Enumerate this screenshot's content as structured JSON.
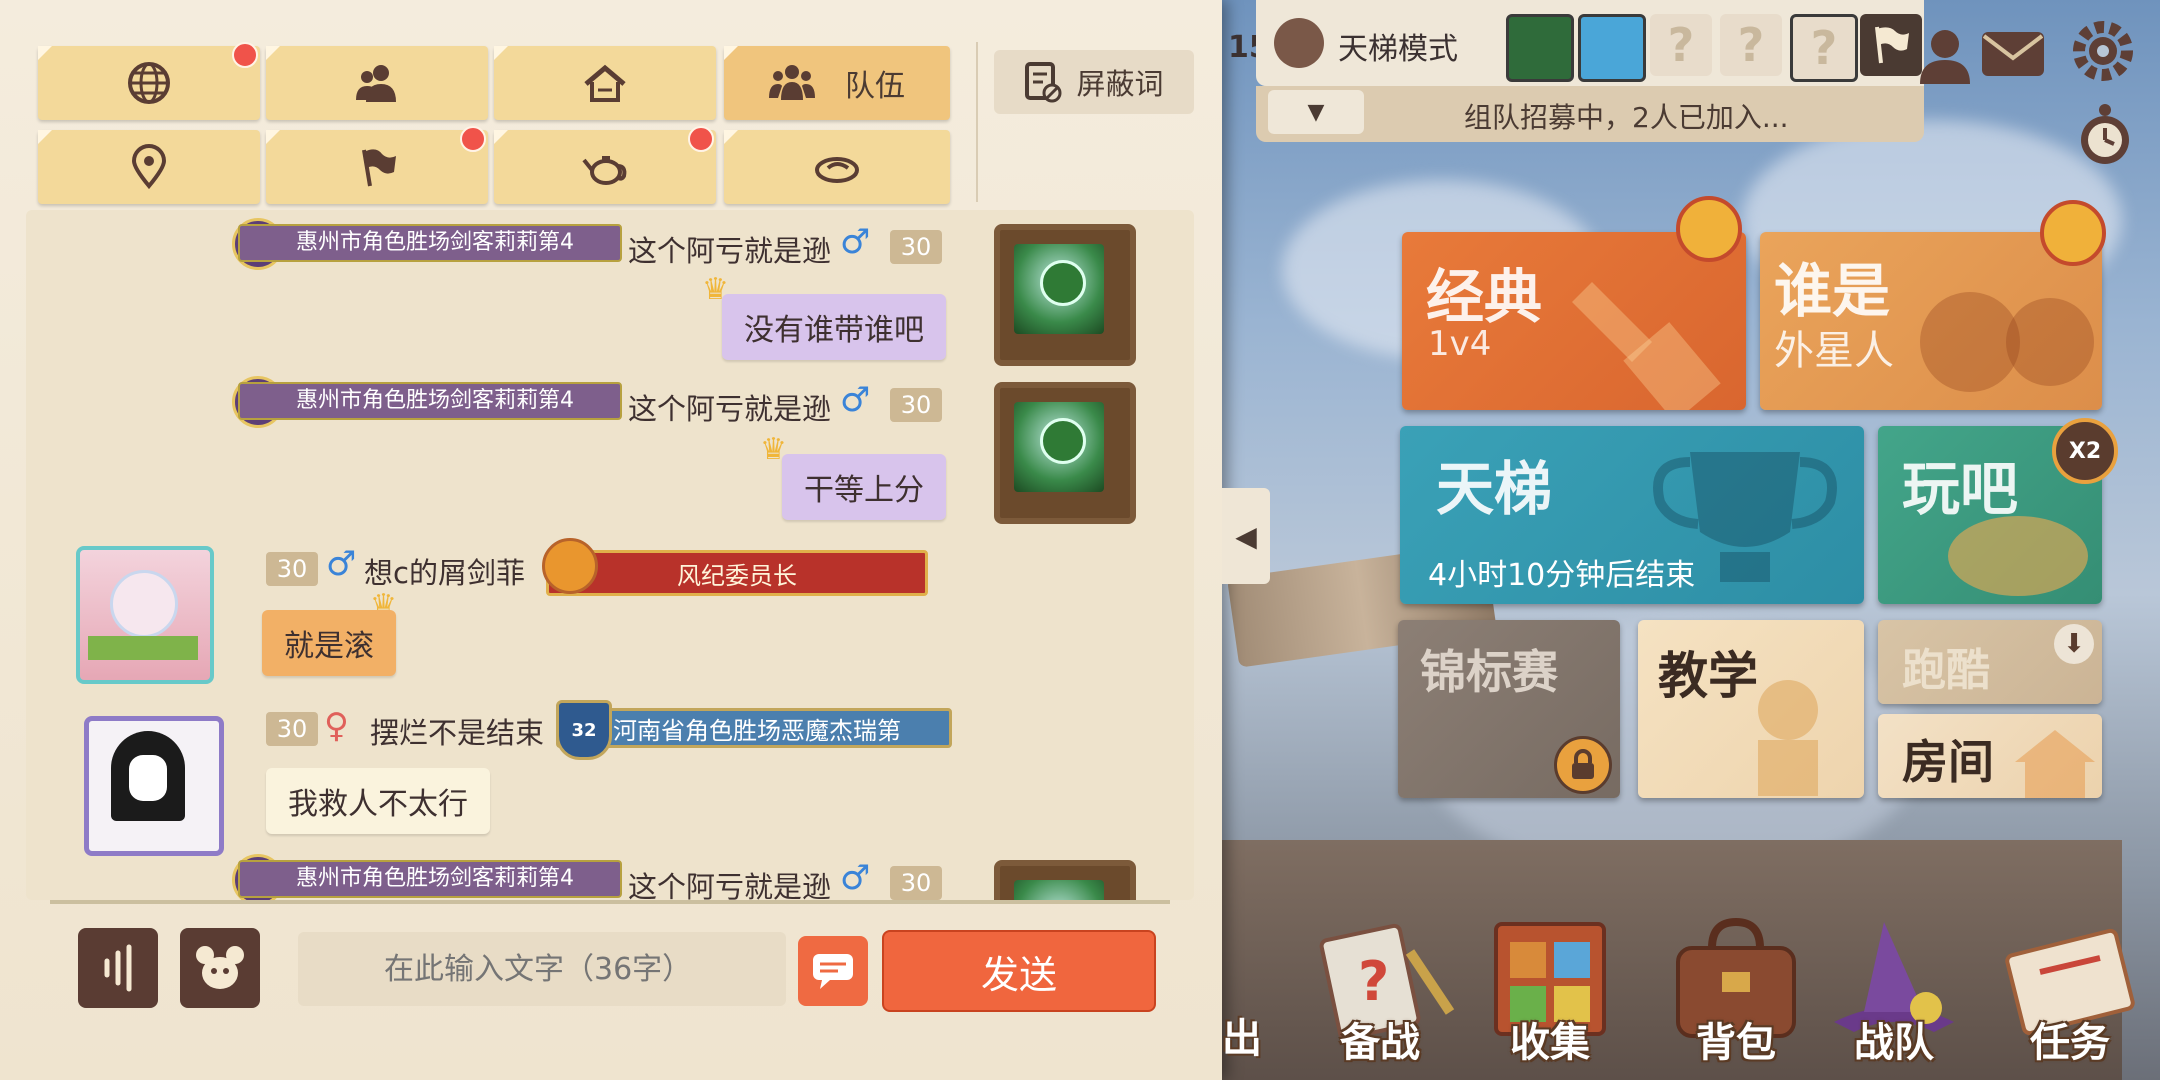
{
  "chat": {
    "tabs": [
      {
        "name": "world",
        "icon": "globe-icon",
        "badge": true
      },
      {
        "name": "friends",
        "icon": "friends-icon",
        "badge": false
      },
      {
        "name": "home",
        "icon": "house-icon",
        "badge": false
      },
      {
        "name": "team",
        "icon": "team-icon",
        "label": "队伍",
        "active": true
      },
      {
        "name": "nearby",
        "icon": "location-pin-icon",
        "badge": false
      },
      {
        "name": "guild",
        "icon": "flag-icon",
        "badge": true
      },
      {
        "name": "teapot",
        "icon": "teapot-icon",
        "badge": true
      },
      {
        "name": "cheese",
        "icon": "hat-icon",
        "badge": false
      }
    ],
    "block_words_label": "屏蔽词",
    "messages": [
      {
        "side": "right",
        "level": "4",
        "title": "惠州市角色胜场剑客莉莉第4",
        "name": "这个阿亏就是逊",
        "gender": "♂",
        "age": "30",
        "text": "没有谁带谁吧"
      },
      {
        "side": "right",
        "level": "4",
        "title": "惠州市角色胜场剑客莉莉第4",
        "name": "这个阿亏就是逊",
        "gender": "♂",
        "age": "30",
        "text": "干等上分"
      },
      {
        "side": "left",
        "age": "30",
        "gender": "♂",
        "name": "想c的屑剑菲",
        "title": "风纪委员长",
        "text": "就是滚"
      },
      {
        "side": "left",
        "age": "30",
        "gender": "♀",
        "name": "摆烂不是结束",
        "level": "32",
        "title": "河南省角色胜场恶魔杰瑞第",
        "text": "我救人不太行"
      },
      {
        "side": "right",
        "level": "4",
        "title": "惠州市角色胜场剑客莉莉第4",
        "name": "这个阿亏就是逊",
        "gender": "♂",
        "age": "30"
      }
    ],
    "input_placeholder": "在此输入文字（36字）",
    "send_label": "发送"
  },
  "mode_panel": {
    "cut_text": "15",
    "title": "天梯模式",
    "slots": [
      "?",
      "?",
      "?"
    ],
    "status": "组队招募中，2人已加入..."
  },
  "cards": {
    "classic": {
      "title": "经典",
      "sub": "1v4"
    },
    "alien": {
      "title": "谁是",
      "sub": "外星人"
    },
    "ladder": {
      "title": "天梯",
      "sub": "4小时10分钟后结束"
    },
    "play": {
      "title": "玩吧",
      "badge": "X2"
    },
    "tournament": {
      "title": "锦标赛"
    },
    "tutorial": {
      "title": "教学"
    },
    "parkour": {
      "title": "跑酷"
    },
    "room": {
      "title": "房间"
    }
  },
  "nav": {
    "cut_label": "出",
    "items": [
      "备战",
      "收集",
      "背包",
      "战队",
      "任务"
    ]
  }
}
